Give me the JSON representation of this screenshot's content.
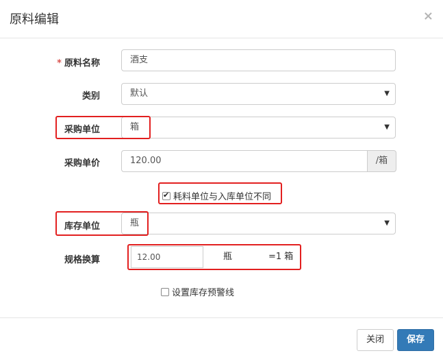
{
  "dialog": {
    "title": "原料编辑",
    "close_glyph": "×"
  },
  "form": {
    "name": {
      "required_mark": "*",
      "label": "原料名称",
      "value": "酒支"
    },
    "category": {
      "label": "类别",
      "value": "默认"
    },
    "purchase_unit": {
      "label": "采购单位",
      "value": "箱"
    },
    "purchase_price": {
      "label": "采购单价",
      "value": "120.00",
      "addon": "/箱"
    },
    "diff_unit_checkbox": {
      "label": "耗料单位与入库单位不同",
      "checked": true
    },
    "stock_unit": {
      "label": "库存单位",
      "value": "瓶"
    },
    "spec": {
      "label": "规格换算",
      "value": "12.00",
      "unit": "瓶",
      "equals": "=1 箱"
    },
    "warning_checkbox": {
      "label": "设置库存预警线",
      "checked": false
    }
  },
  "footer": {
    "close_label": "关闭",
    "save_label": "保存"
  },
  "colors": {
    "primary": "#337ab7",
    "highlight": "#e21f1f",
    "required": "#d9534f"
  }
}
